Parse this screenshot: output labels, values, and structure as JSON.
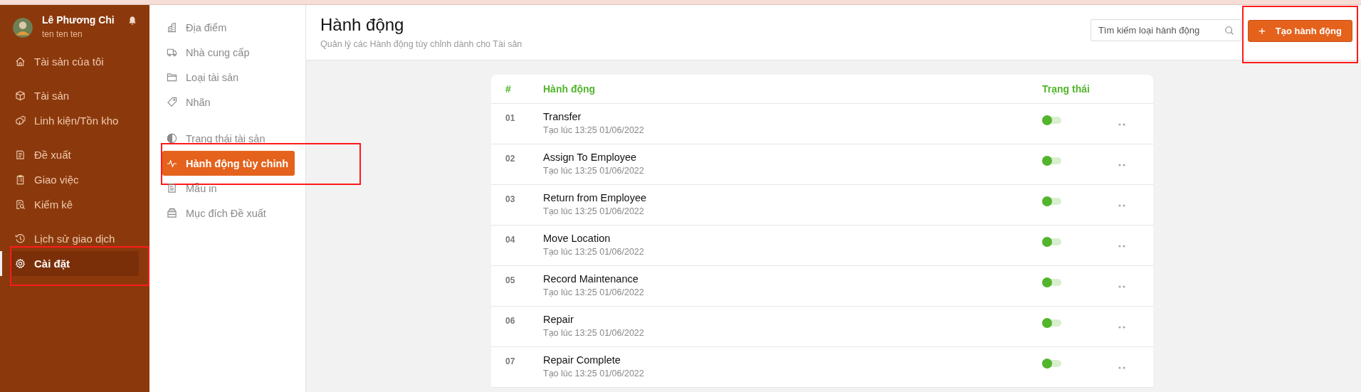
{
  "sidebar": {
    "user": {
      "name": "Lê Phương Chi",
      "subtitle": "ten ten ten"
    },
    "groups": [
      {
        "items": [
          {
            "label": "Tài sản của tôi",
            "selected": false,
            "highlighted": false
          }
        ]
      },
      {
        "items": [
          {
            "label": "Tài sản",
            "selected": false,
            "highlighted": false
          },
          {
            "label": "Linh kiện/Tồn kho",
            "selected": false,
            "highlighted": false
          }
        ]
      },
      {
        "items": [
          {
            "label": "Đề xuất",
            "selected": false,
            "highlighted": false
          },
          {
            "label": "Giao việc",
            "selected": false,
            "highlighted": false
          },
          {
            "label": "Kiếm kê",
            "selected": false,
            "highlighted": false
          }
        ]
      },
      {
        "items": [
          {
            "label": "Lịch sử giao dịch",
            "selected": false,
            "highlighted": false
          },
          {
            "label": "Cài đặt",
            "selected": true,
            "highlighted": true
          }
        ]
      }
    ]
  },
  "settings_menu": {
    "groups": [
      {
        "items": [
          {
            "label": "Địa điểm",
            "selected": false,
            "highlighted": false
          },
          {
            "label": "Nhà cung cấp",
            "selected": false,
            "highlighted": false
          },
          {
            "label": "Loại tài sản",
            "selected": false,
            "highlighted": false
          },
          {
            "label": "Nhãn",
            "selected": false,
            "highlighted": false
          }
        ]
      },
      {
        "items": [
          {
            "label": "Trạng thái tài sản",
            "selected": false,
            "highlighted": false
          },
          {
            "label": "Hành động tùy chỉnh",
            "selected": true,
            "highlighted": true
          },
          {
            "label": "Mẫu in",
            "selected": false,
            "highlighted": false
          },
          {
            "label": "Mục đích Đề xuất",
            "selected": false,
            "highlighted": false
          }
        ]
      }
    ]
  },
  "header": {
    "title": "Hành động",
    "subtitle": "Quản lý các Hành động tùy chỉnh dành cho Tài sản",
    "search": {
      "placeholder": "Tìm kiếm loại hành động"
    },
    "create_button": {
      "icon": "+",
      "label": "Tạo hành động",
      "highlighted": true
    }
  },
  "table": {
    "columns": [
      "#",
      "Hành động",
      "Trạng thái"
    ],
    "rows": [
      {
        "index": "01",
        "name": "Transfer",
        "created": "Tạo lúc 13:25 01/06/2022",
        "on": true
      },
      {
        "index": "02",
        "name": "Assign To Employee",
        "created": "Tạo lúc 13:25 01/06/2022",
        "on": true
      },
      {
        "index": "03",
        "name": "Return from Employee",
        "created": "Tạo lúc 13:25 01/06/2022",
        "on": true
      },
      {
        "index": "04",
        "name": "Move Location",
        "created": "Tạo lúc 13:25 01/06/2022",
        "on": true
      },
      {
        "index": "05",
        "name": "Record Maintenance",
        "created": "Tạo lúc 13:25 01/06/2022",
        "on": true
      },
      {
        "index": "06",
        "name": "Repair",
        "created": "Tạo lúc 13:25 01/06/2022",
        "on": true
      },
      {
        "index": "07",
        "name": "Repair Complete",
        "created": "Tạo lúc 13:25 01/06/2022",
        "on": true
      }
    ]
  }
}
